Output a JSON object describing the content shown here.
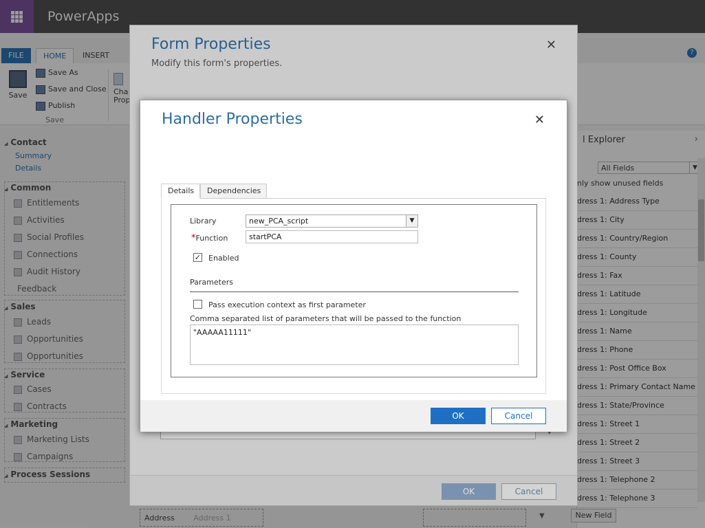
{
  "app": {
    "name": "PowerApps"
  },
  "ribbon": {
    "tabs": [
      "FILE",
      "HOME",
      "INSERT"
    ],
    "save_label": "Save",
    "save_as": "Save As",
    "save_close": "Save and Close",
    "publish": "Publish",
    "group_label": "Save",
    "change_props_1": "Cha",
    "change_props_2": "Prop"
  },
  "left_nav": {
    "entity": "Contact",
    "subs": [
      "Summary",
      "Details"
    ],
    "sections": [
      {
        "title": "Common",
        "items": [
          "Entitlements",
          "Activities",
          "Social Profiles",
          "Connections",
          "Audit History",
          "Feedback"
        ]
      },
      {
        "title": "Sales",
        "items": [
          "Leads",
          "Opportunities",
          "Opportunities"
        ]
      },
      {
        "title": "Service",
        "items": [
          "Cases",
          "Contracts"
        ]
      },
      {
        "title": "Marketing",
        "items": [
          "Marketing Lists",
          "Campaigns"
        ]
      },
      {
        "title": "Process Sessions",
        "items": []
      }
    ]
  },
  "field_explorer": {
    "title": "l Explorer",
    "filter": "All Fields",
    "unused_label": "nly show unused fields",
    "fields": [
      "dress 1: Address Type",
      "dress 1: City",
      "dress 1: Country/Region",
      "dress 1: County",
      "dress 1: Fax",
      "dress 1: Latitude",
      "dress 1: Longitude",
      "dress 1: Name",
      "dress 1: Phone",
      "dress 1: Post Office Box",
      "dress 1: Primary Contact Name",
      "dress 1: State/Province",
      "dress 1: Street 1",
      "dress 1: Street 2",
      "dress 1: Street 3",
      "dress 1: Telephone 2",
      "dress 1: Telephone 3"
    ],
    "new_field": "New Field"
  },
  "canvas": {
    "address_label": "Address",
    "address_placeholder": "Address 1"
  },
  "form_properties": {
    "title": "Form Properties",
    "subtitle": "Modify this form's properties.",
    "ok": "OK",
    "cancel": "Cancel"
  },
  "handler_properties": {
    "title": "Handler Properties",
    "tabs": [
      "Details",
      "Dependencies"
    ],
    "library_label": "Library",
    "library_value": "new_PCA_script",
    "function_label": "Function",
    "function_value": "startPCA",
    "enabled_label": "Enabled",
    "enabled": true,
    "parameters_heading": "Parameters",
    "pass_context_label": "Pass execution context as first parameter",
    "pass_context": false,
    "params_list_label": "Comma separated list of parameters that will be passed to the function",
    "params_value": "\"AAAAA11111\"",
    "ok": "OK",
    "cancel": "Cancel"
  }
}
